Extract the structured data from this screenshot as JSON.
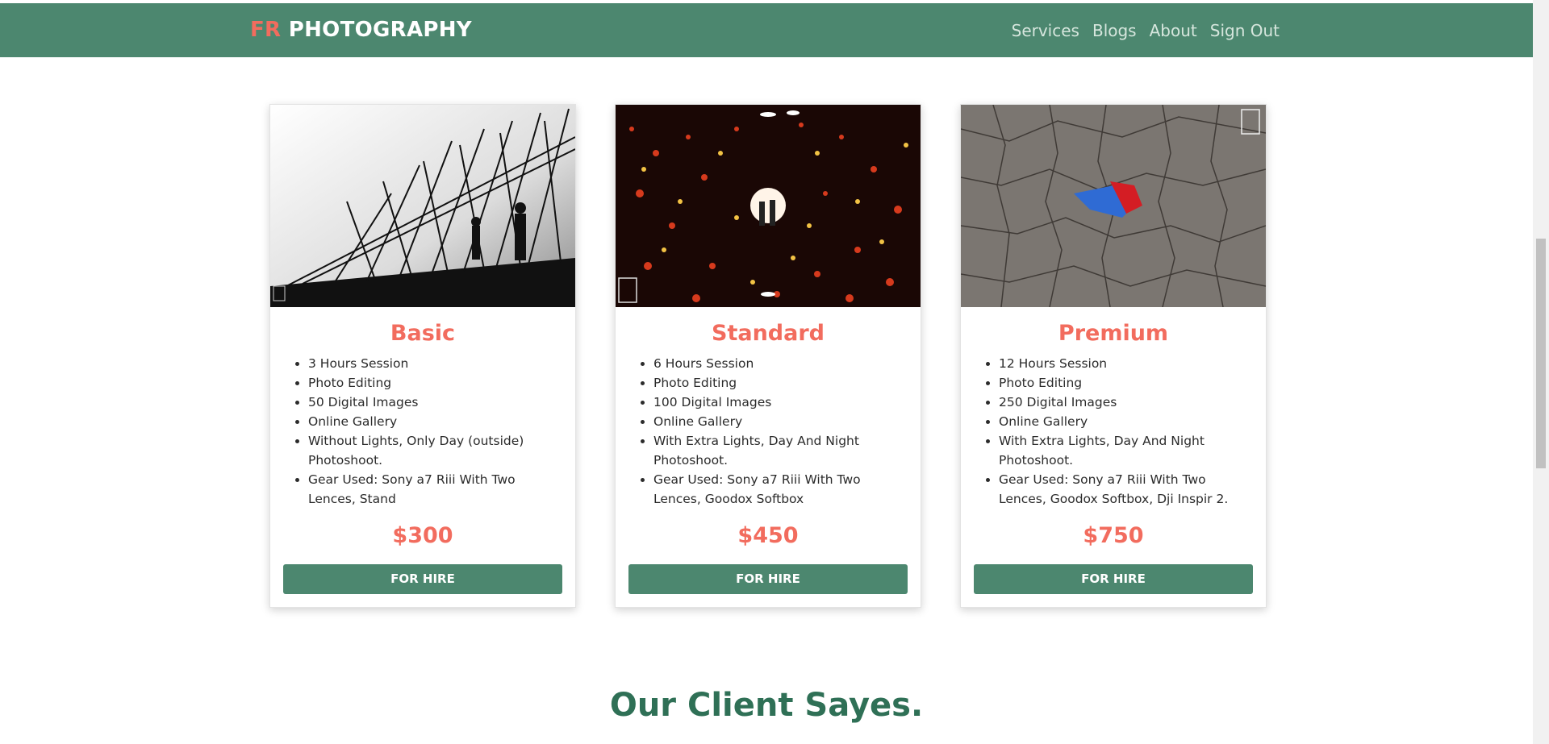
{
  "brand": {
    "prefix": "FR",
    "name": "PHOTOGRAPHY"
  },
  "nav": {
    "items": [
      "Services",
      "Blogs",
      "About",
      "Sign Out"
    ]
  },
  "plans": [
    {
      "title": "Basic",
      "features": [
        "3 Hours Session",
        "Photo Editing",
        "50 Digital Images",
        "Online Gallery",
        "Without Lights, Only Day (outside) Photoshoot.",
        "Gear Used: Sony a7 Riii With Two Lences, Stand"
      ],
      "price": "$300",
      "button": "FOR HIRE"
    },
    {
      "title": "Standard",
      "features": [
        "6 Hours Session",
        "Photo Editing",
        "100 Digital Images",
        "Online Gallery",
        "With Extra Lights, Day And Night Photoshoot.",
        "Gear Used: Sony a7 Riii With Two Lences, Goodox Softbox"
      ],
      "price": "$450",
      "button": "FOR HIRE"
    },
    {
      "title": "Premium",
      "features": [
        "12 Hours Session",
        "Photo Editing",
        "250 Digital Images",
        "Online Gallery",
        "With Extra Lights, Day And Night Photoshoot.",
        "Gear Used: Sony a7 Riii With Two Lences, Goodox Softbox, Dji Inspir 2."
      ],
      "price": "$750",
      "button": "FOR HIRE"
    }
  ],
  "testimonials": {
    "title": "Our Client Sayes."
  },
  "colors": {
    "brand_green": "#4c876f",
    "accent": "#f26c5e",
    "heading_green": "#2f7056"
  }
}
